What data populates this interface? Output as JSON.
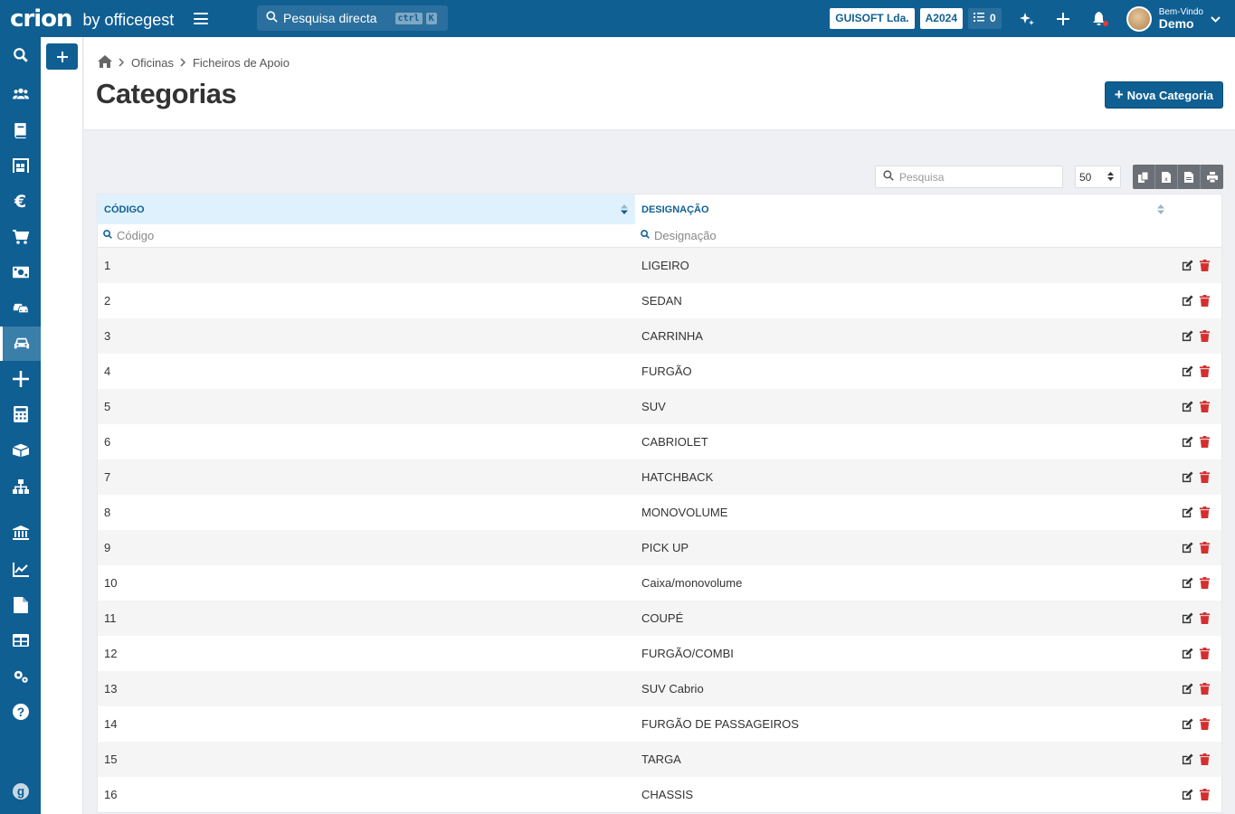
{
  "topbar": {
    "logo_main": "crion",
    "logo_sub": "by officegest",
    "search_placeholder": "Pesquisa directa",
    "kbd1": "ctrl",
    "kbd2": "K",
    "company": "GUISOFT Lda.",
    "year": "A2024",
    "tasks_count": "0",
    "welcome_label": "Bem-Vindo",
    "user_name": "Demo"
  },
  "breadcrumb": {
    "item1": "Oficinas",
    "item2": "Ficheiros de Apoio"
  },
  "page": {
    "title": "Categorias",
    "new_button": "Nova Categoria"
  },
  "table_toolbar": {
    "search_placeholder": "Pesquisa",
    "page_size": "50"
  },
  "table": {
    "columns": [
      "CÓDIGO",
      "DESIGNAÇÃO"
    ],
    "filter_placeholders": [
      "Código",
      "Designação"
    ],
    "rows": [
      [
        "1",
        "LIGEIRO"
      ],
      [
        "2",
        "SEDAN"
      ],
      [
        "3",
        "CARRINHA"
      ],
      [
        "4",
        "FURGÃO"
      ],
      [
        "5",
        "SUV"
      ],
      [
        "6",
        "CABRIOLET"
      ],
      [
        "7",
        "HATCHBACK"
      ],
      [
        "8",
        "MONOVOLUME"
      ],
      [
        "9",
        "PICK UP"
      ],
      [
        "10",
        "Caixa/monovolume"
      ],
      [
        "11",
        "COUPÉ"
      ],
      [
        "12",
        "FURGÃO/COMBI"
      ],
      [
        "13",
        "SUV Cabrio"
      ],
      [
        "14",
        "FURGÃO DE PASSAGEIROS"
      ],
      [
        "15",
        "TARGA"
      ],
      [
        "16",
        "CHASSIS"
      ]
    ]
  },
  "sidebar_icons": [
    "search-icon",
    "users-icon",
    "book-icon",
    "warehouse-icon",
    "euro-icon",
    "cart-icon",
    "money-icon",
    "car-wash-icon",
    "car-icon",
    "plus-icon",
    "calculator-icon",
    "boxes-icon",
    "sitemap-icon",
    "bank-icon",
    "chart-icon",
    "file-icon",
    "table-icon",
    "cogs-icon",
    "help-icon",
    "brand-icon"
  ],
  "colors": {
    "primary": "#0f5f93",
    "delete": "#d32f2f",
    "header_sorted": "#dff1fd"
  }
}
